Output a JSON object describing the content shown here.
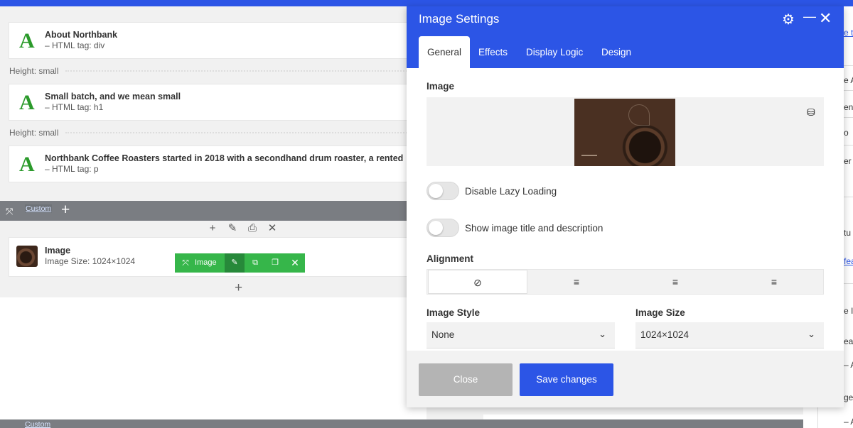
{
  "builder": {
    "blocks": [
      {
        "title": "About Northbank",
        "subtitle": "– HTML tag: div",
        "icon": "text-module-icon"
      },
      {
        "title": "Small batch, and we mean small",
        "subtitle": "– HTML tag: h1",
        "icon": "text-module-icon"
      },
      {
        "title": "Northbank Coffee Roasters started in 2018 with a secondhand drum roaster, a rented",
        "subtitle": "– HTML tag: p",
        "icon": "text-module-icon"
      }
    ],
    "letter": "A",
    "height_labels": [
      "Height: small",
      "Height: small"
    ],
    "custom_label": "Custom",
    "image_block": {
      "title": "Image",
      "subtitle": "Image Size: 1024×1024"
    },
    "green_toolbar_label": "Image",
    "bottom_custom_label": "Custom"
  },
  "right_panel": {
    "fragments": [
      "e t",
      "e A",
      "ent",
      "o",
      "er",
      "tu",
      "fea",
      "e I",
      "ea",
      "– A",
      "ge",
      "– A"
    ]
  },
  "modal": {
    "title": "Image Settings",
    "tabs": [
      "General",
      "Effects",
      "Display Logic",
      "Design"
    ],
    "active_tab": "General",
    "image_section_label": "Image",
    "toggles": [
      {
        "label": "Disable Lazy Loading",
        "on": false
      },
      {
        "label": "Show image title and description",
        "on": false
      }
    ],
    "alignment_label": "Alignment",
    "alignment_options": [
      "none",
      "left",
      "center",
      "right"
    ],
    "alignment_selected": "none",
    "image_style": {
      "label": "Image Style",
      "value": "None"
    },
    "image_size": {
      "label": "Image Size",
      "value": "1024×1024"
    },
    "close_label": "Close",
    "save_label": "Save changes"
  },
  "colors": {
    "accent": "#2c55e6",
    "module_green": "#36b64a",
    "text_icon_green": "#2b9a2b",
    "bar_gray": "#7a7d82"
  }
}
